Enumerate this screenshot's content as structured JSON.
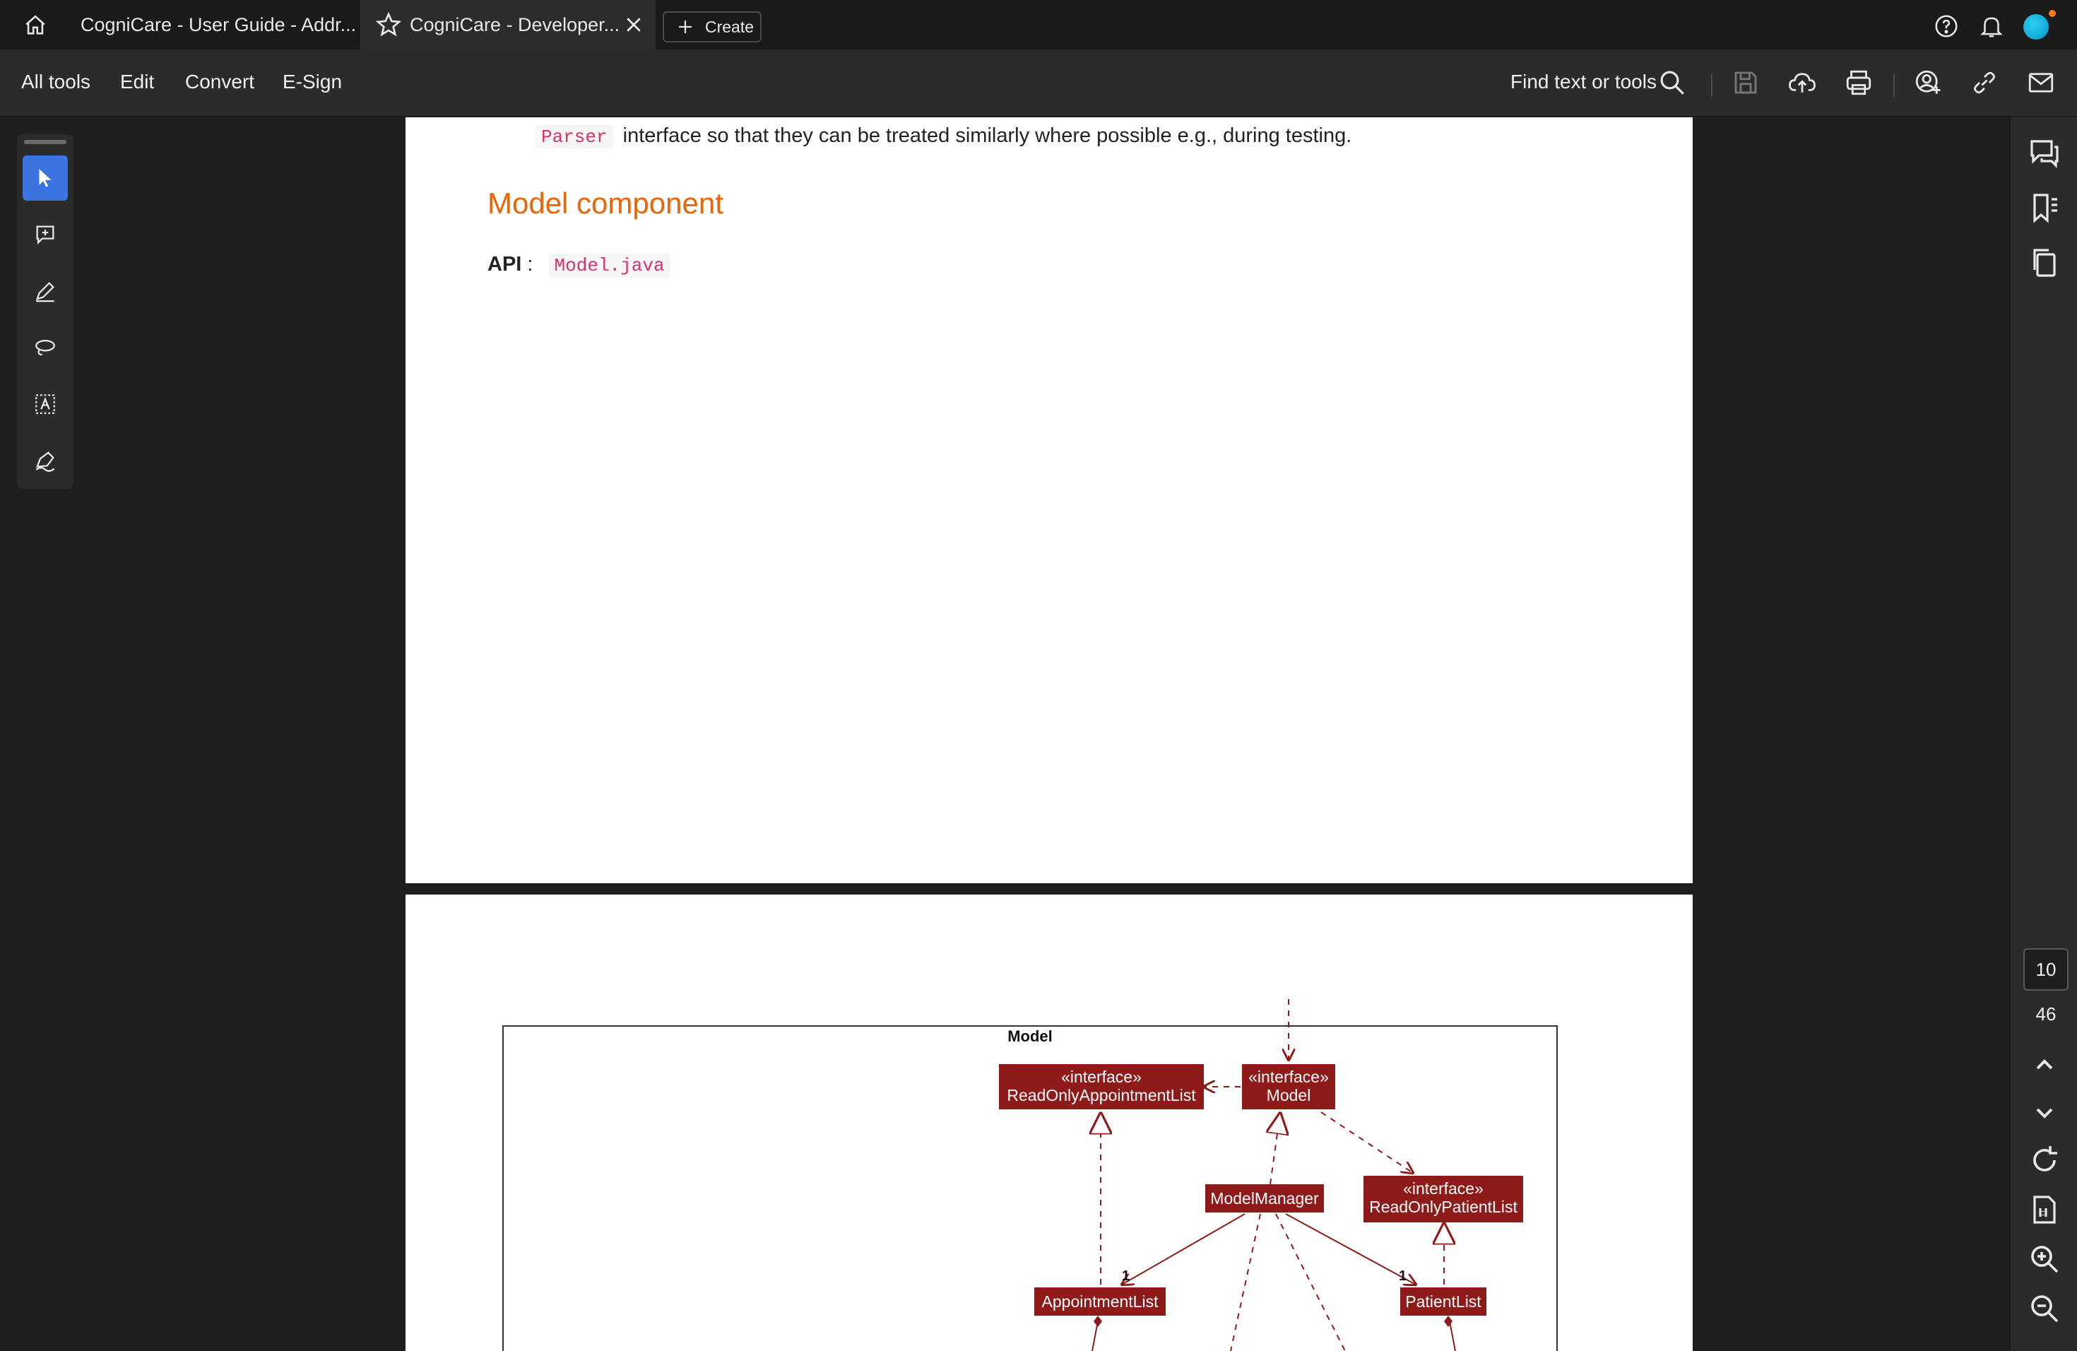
{
  "tabs": [
    {
      "label": "CogniCare - User Guide - Addr..."
    },
    {
      "label": "CogniCare - Developer..."
    }
  ],
  "create_label": "Create",
  "menu": {
    "all_tools": "All tools",
    "edit": "Edit",
    "convert": "Convert",
    "esign": "E-Sign"
  },
  "find_label": "Find text or tools",
  "pagination": {
    "current": "10",
    "total": "46"
  },
  "doc": {
    "line_code": "Parser",
    "line_text": "interface so that they can be treated similarly where possible e.g., during testing.",
    "heading": "Model component",
    "api_label": "API",
    "api_sep": ":",
    "api_code": "Model.java"
  },
  "diagram": {
    "package_title": "Model",
    "classes": [
      {
        "stereotype": "«interface»",
        "name": "ReadOnlyAppointmentList"
      },
      {
        "stereotype": "«interface»",
        "name": "Model"
      },
      {
        "stereotype": "",
        "name": "ModelManager"
      },
      {
        "stereotype": "«interface»",
        "name": "ReadOnlyPatientList"
      },
      {
        "stereotype": "",
        "name": "AppointmentList"
      },
      {
        "stereotype": "",
        "name": "PatientList"
      }
    ],
    "multiplicities": [
      "1",
      "1"
    ],
    "class_color": "#8f1a1a"
  }
}
